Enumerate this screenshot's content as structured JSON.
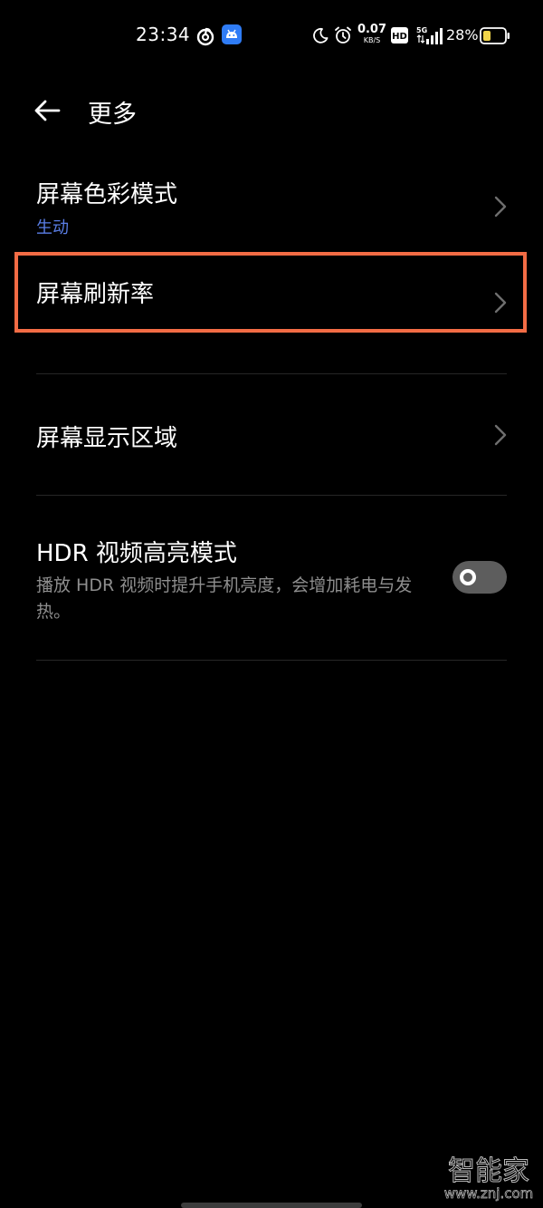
{
  "status_bar": {
    "time": "23:34",
    "net_speed_value": "0.07",
    "net_speed_unit": "KB/S",
    "hd_label": "HD",
    "network_label": "5G",
    "battery_percent": "28%",
    "icons": [
      "netease-music-icon",
      "android-app-icon",
      "moon-icon",
      "alarm-icon",
      "hd-icon",
      "signal-5g-icon",
      "battery-icon"
    ]
  },
  "header": {
    "title": "更多"
  },
  "settings": {
    "items": [
      {
        "title": "屏幕色彩模式",
        "subtitle": "生动"
      },
      {
        "title": "屏幕刷新率"
      },
      {
        "title": "屏幕显示区域"
      },
      {
        "title": "HDR 视频高亮模式",
        "description": "播放 HDR 视频时提升手机亮度，会增加耗电与发热。",
        "toggle_on": false
      }
    ]
  },
  "watermark": {
    "text": "智能家",
    "url": "www.znj.com"
  },
  "colors": {
    "background": "#000000",
    "subtitle_accent": "#5a7ee6",
    "highlight": "#f36c45",
    "battery_fill": "#f1d54a",
    "description": "#8e8e8e"
  }
}
